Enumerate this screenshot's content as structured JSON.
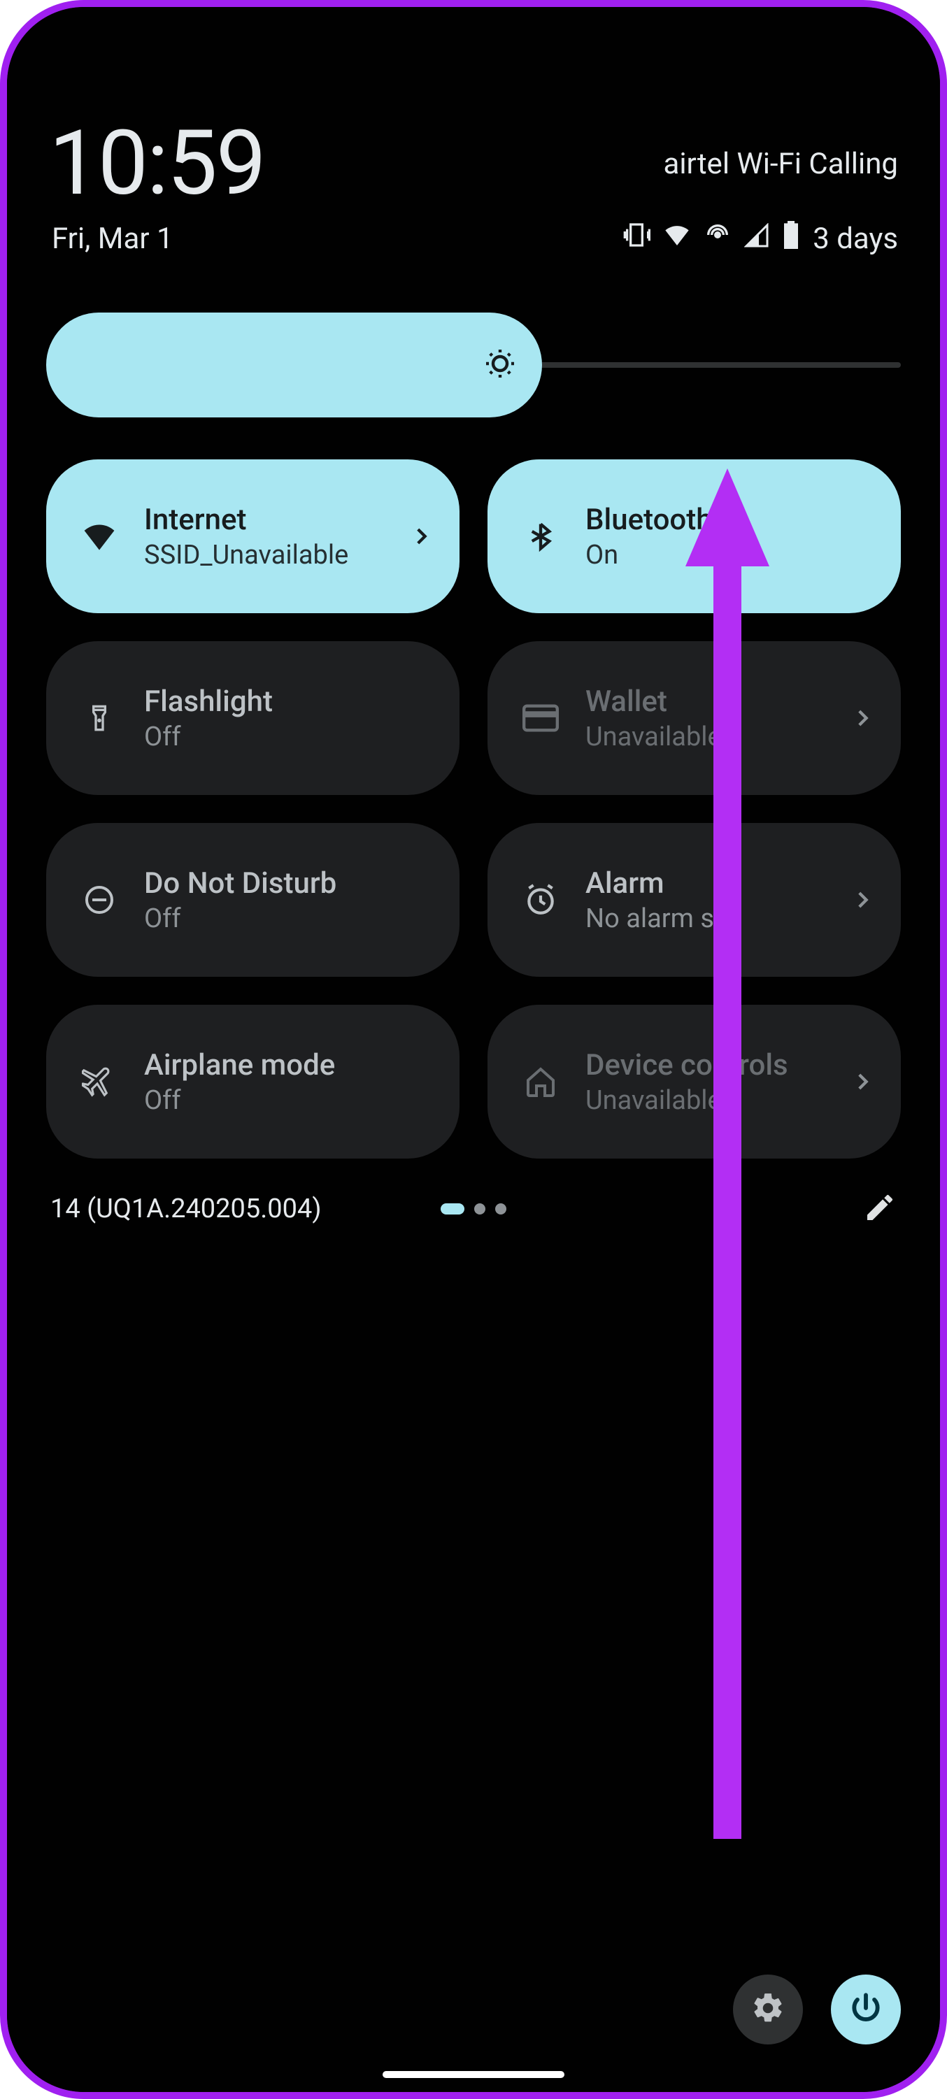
{
  "clock": "10:59",
  "carrier_label": "airtel Wi-Fi Calling",
  "date": "Fri, Mar 1",
  "battery_text": "3 days",
  "brightness": {
    "percent": 58
  },
  "tiles": {
    "internet": {
      "title": "Internet",
      "sub": "SSID_Unavailable"
    },
    "bluetooth": {
      "title": "Bluetooth",
      "sub": "On"
    },
    "flashlight": {
      "title": "Flashlight",
      "sub": "Off"
    },
    "wallet": {
      "title": "Wallet",
      "sub": "Unavailable"
    },
    "dnd": {
      "title": "Do Not Disturb",
      "sub": "Off"
    },
    "alarm": {
      "title": "Alarm",
      "sub": "No alarm set"
    },
    "airplane": {
      "title": "Airplane mode",
      "sub": "Off"
    },
    "device": {
      "title": "Device controls",
      "sub": "Unavailable"
    }
  },
  "build": "14 (UQ1A.240205.004)",
  "accent_color": "#a9e7f2",
  "annotation_arrow_color": "#b32ef4"
}
